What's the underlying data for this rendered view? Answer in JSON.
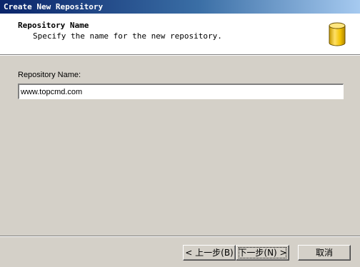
{
  "window": {
    "title": "Create New Repository"
  },
  "header": {
    "title": "Repository Name",
    "subtitle": "Specify the name for the new repository.",
    "icon": "repository-cylinder-icon"
  },
  "form": {
    "name_label": "Repository Name:",
    "name_value": "www.topcmd.com"
  },
  "buttons": {
    "back_label": "< 上一步(B)",
    "next_label": "下一步(N) >",
    "cancel_label": "取消"
  },
  "colors": {
    "titlebar_start": "#0a246a",
    "titlebar_end": "#a6caf0",
    "dialog_face": "#d4d0c8",
    "header_bg": "#ffffff",
    "icon_fill": "#f2c200"
  }
}
